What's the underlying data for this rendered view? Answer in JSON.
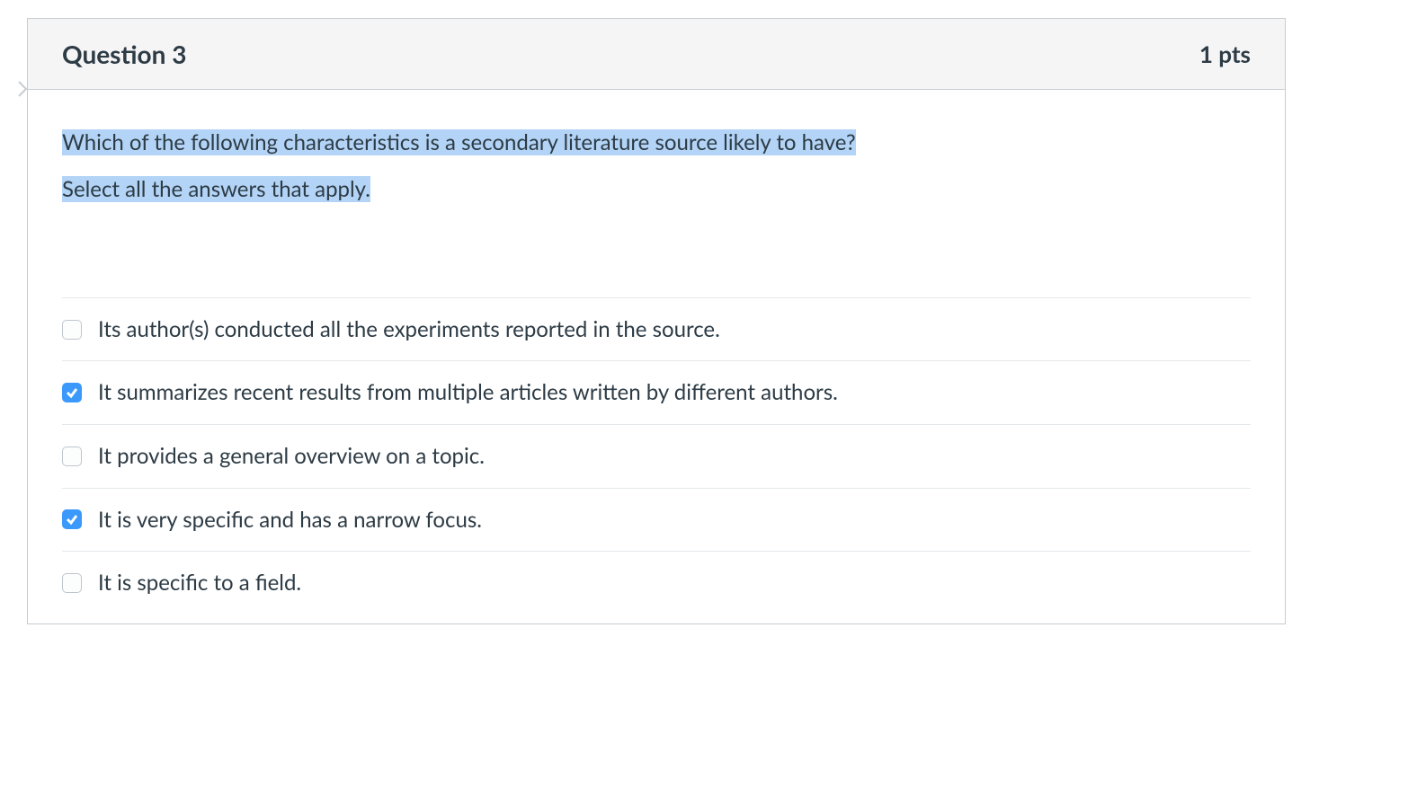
{
  "question": {
    "title": "Question 3",
    "points": "1 pts",
    "stem_line1": "Which of the following characteristics is a secondary literature source likely to have?",
    "stem_line2": "Select all the answers that apply."
  },
  "answers": [
    {
      "label": "Its author(s) conducted all the experiments reported in the source.",
      "checked": false
    },
    {
      "label": "It summarizes recent results from multiple articles written by different authors.",
      "checked": true
    },
    {
      "label": "It provides a general overview on a topic.",
      "checked": false
    },
    {
      "label": "It is very specific and has a narrow focus.",
      "checked": true
    },
    {
      "label": "It is specific to a field.",
      "checked": false
    }
  ]
}
